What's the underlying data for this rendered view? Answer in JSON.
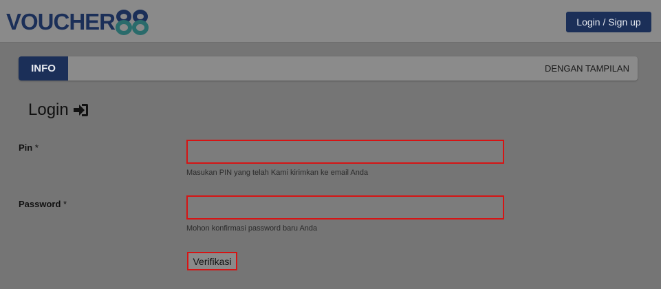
{
  "header": {
    "logo_text": "VOUCHER",
    "logo_number": "88",
    "login_signup_label": "Login / Sign up"
  },
  "info_bar": {
    "tab_label": "INFO",
    "marquee_text": "DENGAN TAMPILAN"
  },
  "form": {
    "title": "Login",
    "pin": {
      "label": "Pin",
      "required_mark": "*",
      "value": "",
      "help": "Masukan PIN yang telah Kami kirimkan ke email Anda"
    },
    "password": {
      "label": "Password",
      "required_mark": "*",
      "value": "",
      "help": "Mohon konfirmasi password baru Anda"
    },
    "submit_label": "Verifikasi"
  },
  "colors": {
    "brand_navy": "#1b2f58",
    "error_red": "#d61414",
    "overlay_gray": "#757575"
  },
  "icons": {
    "login_heading_icon": "sign-in-icon",
    "logo_mark": "voucher88-logo"
  }
}
